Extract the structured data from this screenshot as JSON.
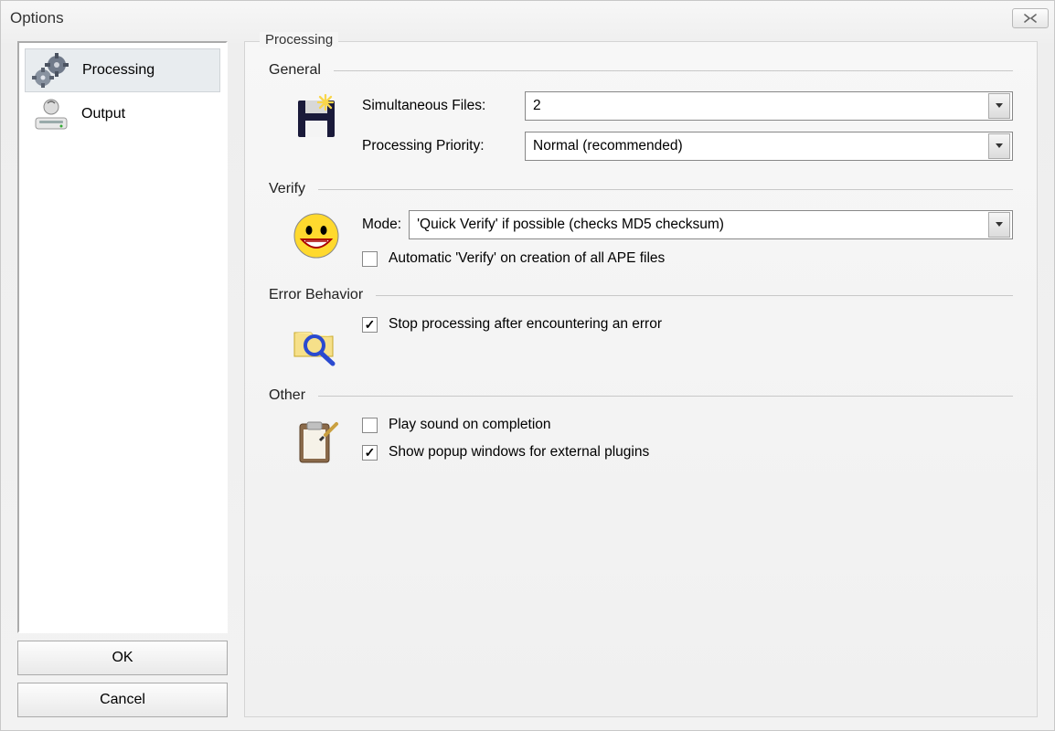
{
  "window": {
    "title": "Options"
  },
  "buttons": {
    "ok": "OK",
    "cancel": "Cancel"
  },
  "nav": {
    "items": [
      {
        "label": "Processing"
      },
      {
        "label": "Output"
      }
    ]
  },
  "panel": {
    "title": "Processing",
    "general": {
      "title": "General",
      "simultaneous_label": "Simultaneous Files:",
      "simultaneous_value": "2",
      "priority_label": "Processing Priority:",
      "priority_value": "Normal (recommended)"
    },
    "verify": {
      "title": "Verify",
      "mode_label": "Mode:",
      "mode_value": "'Quick Verify' if possible (checks MD5 checksum)",
      "auto_label": "Automatic 'Verify' on creation of all APE files",
      "auto_checked": false
    },
    "error": {
      "title": "Error Behavior",
      "stop_label": "Stop processing after encountering an error",
      "stop_checked": true
    },
    "other": {
      "title": "Other",
      "play_label": "Play sound on completion",
      "play_checked": false,
      "popup_label": "Show popup windows for external plugins",
      "popup_checked": true
    }
  }
}
